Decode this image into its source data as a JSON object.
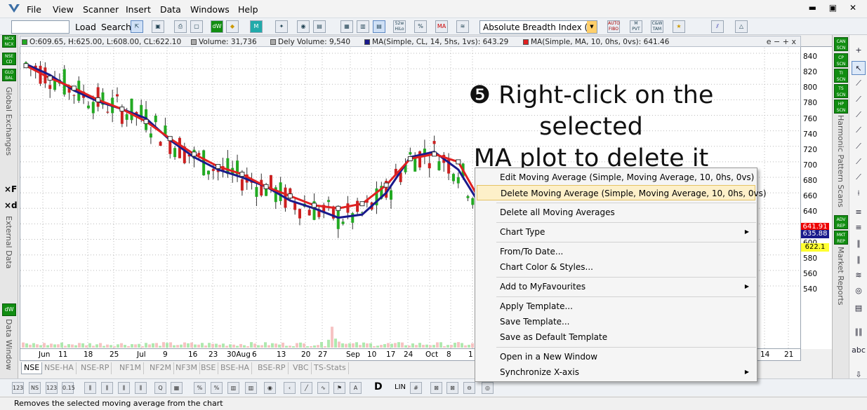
{
  "menu": {
    "items": [
      "File",
      "View",
      "Scanner",
      "Insert",
      "Data",
      "Windows",
      "Help"
    ],
    "window_controls": "▬ ▣ ✕"
  },
  "toolbar": {
    "load_label": "Load",
    "search_label": "Search",
    "indicator_selected": "Absolute Breadth Index (ABI",
    "icons": [
      "chart-type-icon",
      "save-icon",
      "print-icon",
      "print-preview-icon",
      "dw-icon",
      "diamond-icon",
      "mk-icon",
      "puzzle-icon",
      "globe-icon",
      "page-icon",
      "volume-bars-icon",
      "cv-icon",
      "vp-icon",
      "52w-hilo-icon",
      "pct-icon",
      "ma-icon",
      "wave-icon",
      "auto-fibo-icon",
      "m-pvt-icon",
      "cow-tam-icon",
      "tas-icon",
      "line-tool-icon",
      "triangle-tool-icon"
    ],
    "icon_labels": {
      "fifty_two_week": "52w\nHiLo",
      "auto_fibo": "AUTO\nFIBO",
      "m_pvt": "M\nPVT",
      "cow_tam": "C&W\nTAM"
    }
  },
  "left_rail": {
    "badges": [
      "MCX NCX",
      "NSE CD",
      "GLO BAL"
    ],
    "global_exchanges": "Global Exchanges",
    "xf_label": "×F",
    "xd_label": "×d",
    "external_data": "External Data",
    "dw_label": "dW",
    "data_window": "Data Window"
  },
  "legend": {
    "ohlc": "O:609.65, H:625.00, L:608.00, CL:622.10",
    "volume": "Volume: 31,736",
    "dely_volume": "Dely Volume: 9,540",
    "ma1": "MA(Simple, CL, 14, 5hs, 1vs): 643.29",
    "ma2": "MA(Simple, MA, 10, 0hs, 0vs): 641.46",
    "controls": "e − + x",
    "ma1_color": "#1a1a8c",
    "ma2_color": "#e02020",
    "ohlc_color": "#22aa22",
    "volume_color": "#999999"
  },
  "price_axis": {
    "ticks": [
      "840",
      "820",
      "800",
      "780",
      "760",
      "740",
      "720",
      "700",
      "680",
      "660",
      "640",
      "620",
      "600",
      "580",
      "560",
      "540"
    ],
    "tag_red": "641.91",
    "tag_blue": "635.88",
    "tag_yellow": "622.1"
  },
  "x_axis": {
    "ticks": [
      "Jun",
      "11",
      "18",
      "25",
      "Jul",
      "9",
      "16",
      "23",
      "30Aug",
      "6",
      "13",
      "20",
      "27",
      "Sep",
      "10",
      "17",
      "24",
      "Oct",
      "8",
      "1",
      "14",
      "21"
    ]
  },
  "sheet_tabs": [
    "NSE",
    "NSE-HA",
    "NSE-RP",
    "NF1M",
    "NF2M",
    "NF3M",
    "BSE",
    "BSE-HA",
    "BSE-RP",
    "VBC",
    "TS-Stats"
  ],
  "scan_rail": {
    "badges": [
      "CAN SCN",
      "CP SCN",
      "TI SCN",
      "TS SCN",
      "HP SCN"
    ],
    "harmonic": "Harmonic Pattern Scans",
    "report_badges": [
      "ADV REP",
      "MKT REP"
    ],
    "market_reports": "Market Reports"
  },
  "draw_rail": {
    "tools": [
      "+",
      "↖",
      "⟋",
      "⟋",
      "⟋",
      "⟋",
      "⟋",
      "⟋",
      "⟋",
      "⟊",
      "≡",
      "≡",
      "∥",
      "∥",
      "≋",
      "◎",
      "▤",
      "∥∥",
      "abc",
      "⇩",
      "⇦"
    ]
  },
  "annotation": {
    "line1": "❺ Right-click on the selected",
    "line2": "MA plot to delete it"
  },
  "context_menu": {
    "items": [
      "Edit Moving Average (Simple, Moving Average, 10, 0hs, 0vs)",
      "Delete Moving Average (Simple, Moving Average, 10, 0hs, 0vs)",
      "Delete all Moving Averages",
      "Chart Type",
      "From/To Date...",
      "Chart Color & Styles...",
      "Add to MyFavourites",
      "Apply Template...",
      "Save Template...",
      "Save as Default Template",
      "Open in a New Window",
      "Synchronize X-axis"
    ],
    "submenu_arrow": "▶"
  },
  "bottom_toolbar": {
    "labels": [
      "123",
      "NS",
      "123",
      "0.15",
      "LIN",
      "D"
    ]
  },
  "status": {
    "text": "Removes the selected moving average from the chart"
  },
  "chart_data": {
    "type": "line",
    "ylim": [
      530,
      845
    ],
    "x": [
      "Jun",
      "11",
      "18",
      "25",
      "Jul",
      "9",
      "16",
      "23",
      "30Aug",
      "6",
      "13",
      "20",
      "27",
      "Sep",
      "10",
      "17",
      "24",
      "Oct",
      "8",
      "1"
    ],
    "series": [
      {
        "name": "MA(Simple, CL, 14, 5hs, 1vs)",
        "color": "#1a1a8c",
        "values": [
          826,
          812,
          792,
          778,
          768,
          756,
          728,
          706,
          690,
          680,
          668,
          650,
          640,
          628,
          632,
          660,
          706,
          713,
          690,
          640
        ]
      },
      {
        "name": "MA(Simple, MA, 10, 0hs, 0vs)",
        "color": "#e02020",
        "values": [
          824,
          808,
          795,
          780,
          768,
          752,
          730,
          710,
          694,
          684,
          668,
          656,
          644,
          640,
          646,
          670,
          704,
          710,
          700,
          645
        ]
      }
    ]
  }
}
